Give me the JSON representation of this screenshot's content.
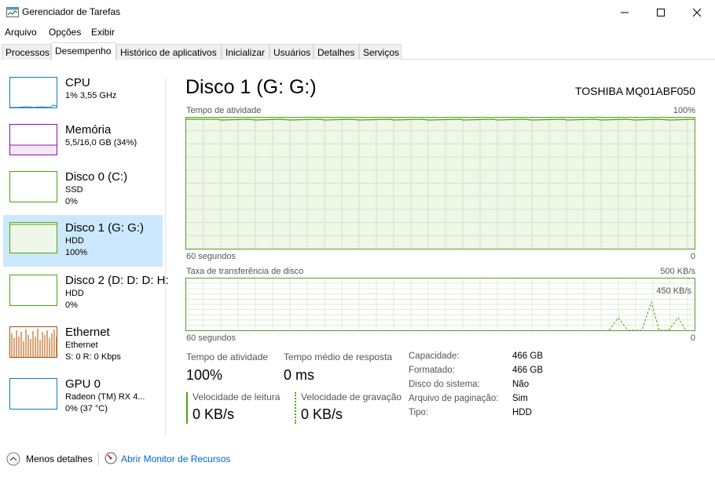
{
  "window": {
    "title": "Gerenciador de Tarefas"
  },
  "menu": [
    "Arquivo",
    "Opções",
    "Exibir"
  ],
  "tabs": [
    "Processos",
    "Desempenho",
    "Histórico de aplicativos",
    "Inicializar",
    "Usuários",
    "Detalhes",
    "Serviços"
  ],
  "active_tab": "Desempenho",
  "sidebar": {
    "items": [
      {
        "title": "CPU",
        "sub1": "1%  3,55 GHz",
        "sub2": "",
        "color": "#117dbb"
      },
      {
        "title": "Memória",
        "sub1": "5,5/16,0 GB (34%)",
        "sub2": "",
        "color": "#8b12ae"
      },
      {
        "title": "Disco 0 (C:)",
        "sub1": "SSD",
        "sub2": "0%",
        "color": "#4da60c"
      },
      {
        "title": "Disco 1 (G: G:)",
        "sub1": "HDD",
        "sub2": "100%",
        "color": "#4da60c"
      },
      {
        "title": "Disco 2 (D: D: D: H:",
        "sub1": "HDD",
        "sub2": "0%",
        "color": "#4da60c"
      },
      {
        "title": "Ethernet",
        "sub1": "Ethernet",
        "sub2": "S: 0 R: 0 Kbps",
        "color": "#a74f01"
      },
      {
        "title": "GPU 0",
        "sub1": "Radeon (TM) RX 4...",
        "sub2": "0%  (37 °C)",
        "color": "#117dbb"
      }
    ],
    "selected_index": 3
  },
  "main": {
    "title": "Disco 1 (G: G:)",
    "model": "TOSHIBA MQ01ABF050",
    "chart1": {
      "label": "Tempo de atividade",
      "max": "100%",
      "x_left": "60 segundos",
      "x_right": "0"
    },
    "chart2": {
      "label": "Taxa de transferência de disco",
      "max": "500 KB/s",
      "inner": "450 KB/s",
      "x_left": "60 segundos",
      "x_right": "0"
    },
    "stats": {
      "active_label": "Tempo de atividade",
      "active_value": "100%",
      "response_label": "Tempo médio de resposta",
      "response_value": "0 ms",
      "read_label": "Velocidade de leitura",
      "read_value": "0 KB/s",
      "write_label": "Velocidade de gravação",
      "write_value": "0 KB/s"
    },
    "info": [
      {
        "label": "Capacidade:",
        "value": "466 GB"
      },
      {
        "label": "Formatado:",
        "value": "466 GB"
      },
      {
        "label": "Disco do sistema:",
        "value": "Não"
      },
      {
        "label": "Arquivo de paginação:",
        "value": "Sim"
      },
      {
        "label": "Tipo:",
        "value": "HDD"
      }
    ]
  },
  "footer": {
    "fewer_details": "Menos detalhes",
    "resource_monitor": "Abrir Monitor de Recursos"
  },
  "colors": {
    "disk_green": "#4da60c",
    "disk_fill": "#eff7e9",
    "selected_bg": "#cce8ff",
    "link": "#0066cc"
  }
}
